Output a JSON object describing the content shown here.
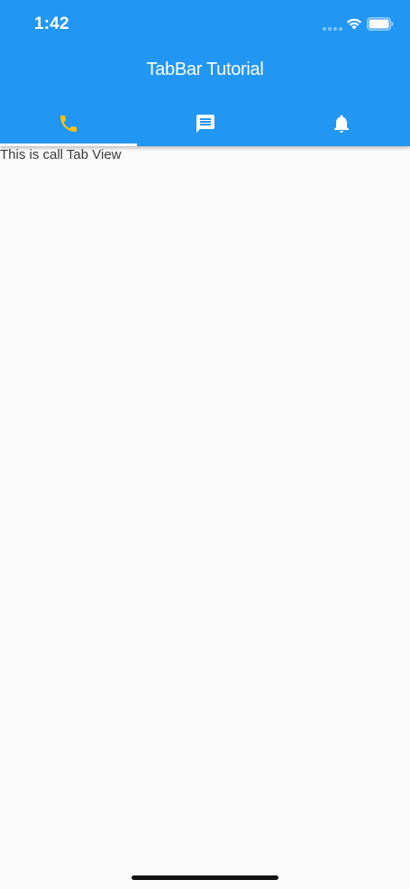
{
  "status_bar": {
    "time": "1:42"
  },
  "app_bar": {
    "title": "TabBar Tutorial",
    "background_color": "#2196f3"
  },
  "tabs": [
    {
      "icon": "phone-icon",
      "selected": true,
      "icon_color": "#ffc107"
    },
    {
      "icon": "message-icon",
      "selected": false,
      "icon_color": "#ffffff"
    },
    {
      "icon": "bell-icon",
      "selected": false,
      "icon_color": "#ffffff"
    }
  ],
  "content": {
    "text": "This is call Tab View"
  }
}
